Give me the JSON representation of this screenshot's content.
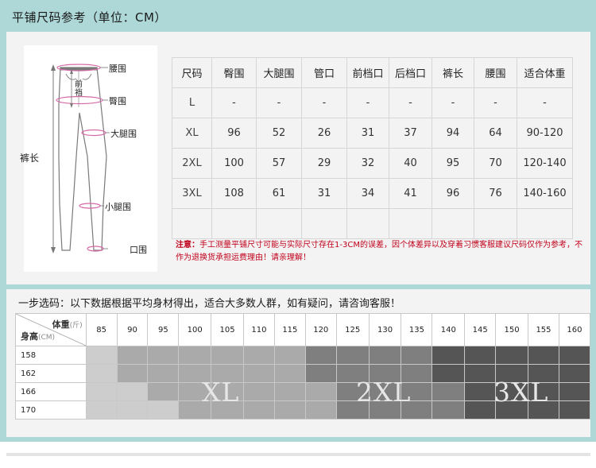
{
  "title": "平铺尺码参考（单位：CM）",
  "figure": {
    "labels": [
      "腰围",
      "臀围",
      "大腿围",
      "小腿围",
      "口围"
    ],
    "left_label": "裤长",
    "front_rise": "前裆"
  },
  "size_table": {
    "headers": [
      "尺码",
      "臀围",
      "大腿围",
      "管口",
      "前档口",
      "后档口",
      "裤长",
      "腰围",
      "适合体重"
    ],
    "rows": [
      [
        "L",
        "-",
        "-",
        "-",
        "-",
        "-",
        "-",
        "-",
        "-"
      ],
      [
        "XL",
        "96",
        "52",
        "26",
        "31",
        "37",
        "94",
        "64",
        "90-120"
      ],
      [
        "2XL",
        "100",
        "57",
        "29",
        "32",
        "40",
        "95",
        "70",
        "120-140"
      ],
      [
        "3XL",
        "108",
        "61",
        "31",
        "34",
        "41",
        "96",
        "76",
        "140-160"
      ],
      [
        "",
        "",
        "",
        "",
        "",
        "",
        "",
        "",
        ""
      ]
    ]
  },
  "note": {
    "label": "注意：",
    "text": "手工测量平铺尺寸可能与实际尺寸存在1-3CM的误差，因个体差异以及穿着习惯客服建议尺码仅作为参考，不作为退换货承担运费理由！请亲理解！"
  },
  "recommend": {
    "subtitle": "一步选码：以下数据根据平均身材得出，适合大多数人群，如有疑问，请咨询客服！",
    "weight_label": "体重",
    "weight_unit": "(斤)",
    "height_label": "身高",
    "height_unit": "(CM)",
    "weights": [
      "85",
      "90",
      "95",
      "100",
      "105",
      "110",
      "115",
      "120",
      "125",
      "130",
      "135",
      "140",
      "145",
      "150",
      "155",
      "160"
    ],
    "heights": [
      "158",
      "162",
      "166",
      "170"
    ],
    "grid": [
      [
        1,
        2,
        2,
        2,
        2,
        2,
        2,
        3,
        3,
        3,
        3,
        4,
        4,
        4,
        4,
        4
      ],
      [
        1,
        2,
        2,
        2,
        2,
        2,
        2,
        3,
        3,
        3,
        3,
        4,
        4,
        4,
        4,
        4
      ],
      [
        1,
        1,
        2,
        2,
        2,
        2,
        2,
        2,
        3,
        3,
        3,
        3,
        4,
        4,
        4,
        4
      ],
      [
        1,
        1,
        1,
        2,
        2,
        2,
        2,
        2,
        3,
        3,
        3,
        3,
        4,
        4,
        4,
        4
      ]
    ],
    "shade_colors": [
      "#ffffff",
      "#cdcdcd",
      "#aaaaaa",
      "#7f7f7f",
      "#555555"
    ],
    "zone_labels": [
      "XL",
      "2XL",
      "3XL"
    ]
  }
}
